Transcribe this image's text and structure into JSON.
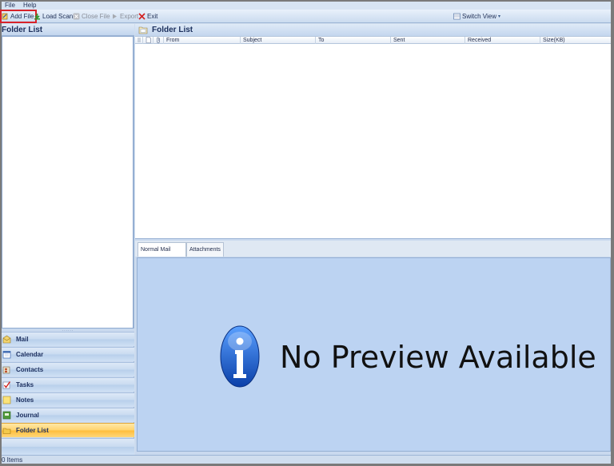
{
  "menu": {
    "file": "File",
    "help": "Help"
  },
  "toolbar": {
    "add_file": "Add File",
    "load_scan": "Load Scan",
    "close_file": "Close File",
    "export": "Export",
    "exit": "Exit",
    "switch_view": "Switch View"
  },
  "left_pane": {
    "title": "Folder List",
    "splitter_glyph": "......",
    "nav": [
      {
        "label": "Mail",
        "icon": "mail-icon"
      },
      {
        "label": "Calendar",
        "icon": "calendar-icon"
      },
      {
        "label": "Contacts",
        "icon": "contacts-icon"
      },
      {
        "label": "Tasks",
        "icon": "tasks-icon"
      },
      {
        "label": "Notes",
        "icon": "notes-icon"
      },
      {
        "label": "Journal",
        "icon": "journal-icon"
      },
      {
        "label": "Folder List",
        "icon": "folder-icon"
      }
    ]
  },
  "right_pane": {
    "title": "Folder List",
    "columns": [
      "From",
      "Subject",
      "To",
      "Sent",
      "Received",
      "Size(KB)"
    ],
    "tabs": [
      "Normal Mail View",
      "Attachments"
    ],
    "preview_message": "No Preview Available"
  },
  "status": {
    "items": "0 Items"
  },
  "colors": {
    "accent_red": "#d7222a",
    "active_nav": "#ffc94a",
    "preview_bg": "#bcd3f2"
  }
}
